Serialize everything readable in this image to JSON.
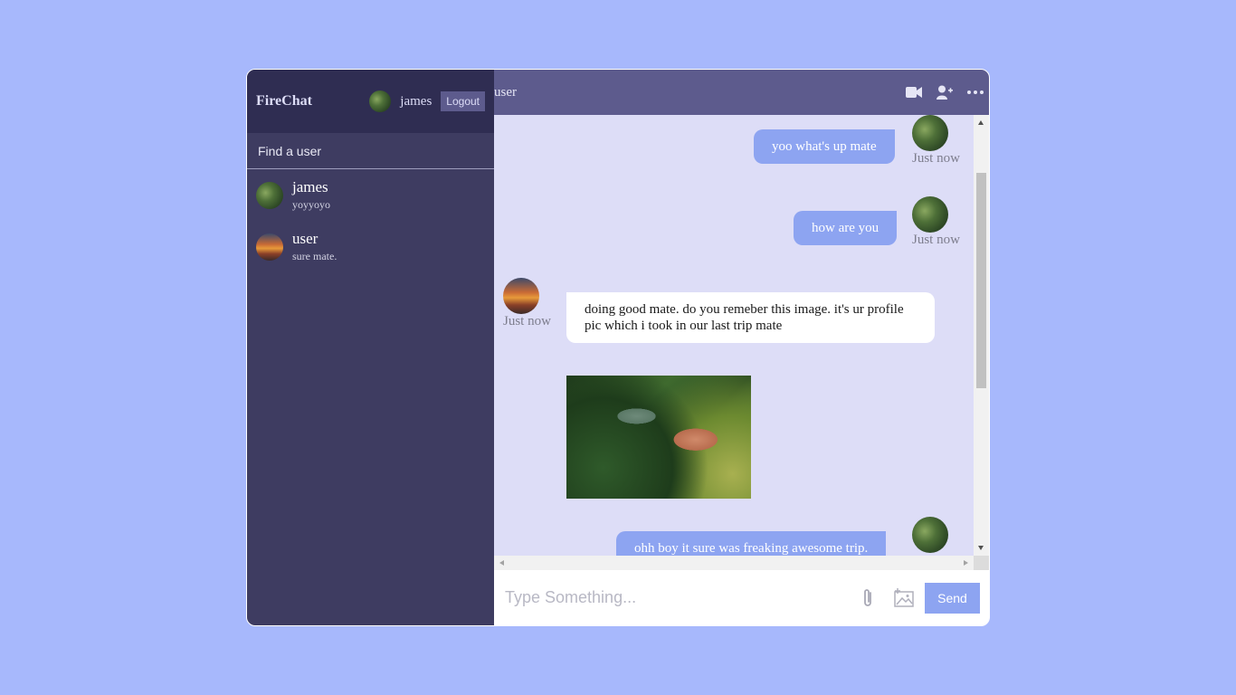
{
  "sidebar": {
    "brand": "FireChat",
    "current_user": "james",
    "logout_label": "Logout",
    "search_placeholder": "Find a user",
    "chats": [
      {
        "name": "james",
        "last_message": "yoyyoyo"
      },
      {
        "name": "user",
        "last_message": "sure mate."
      }
    ]
  },
  "chat": {
    "title": "user",
    "icons": [
      "video-camera-icon",
      "add-user-icon",
      "more-icon"
    ],
    "messages": [
      {
        "from": "owner",
        "text": "yoo what's up mate",
        "time": "Just now"
      },
      {
        "from": "owner",
        "text": "how are you",
        "time": "Just now"
      },
      {
        "from": "other",
        "text": "doing good mate. do you remeber this image. it's ur profile pic which i took in our last trip mate",
        "time": "Just now"
      },
      {
        "from": "other",
        "image": true
      },
      {
        "from": "owner",
        "text": "ohh boy it sure was freaking awesome trip."
      }
    ],
    "input_placeholder": "Type Something...",
    "send_label": "Send"
  },
  "colors": {
    "background": "#a7b8fc",
    "sidebar": "#3e3c61",
    "sidebar_header": "#2f2d52",
    "chat_header": "#5d5b8d",
    "chat_bg": "#ddddf7",
    "owner_bubble": "#8da4f1"
  }
}
